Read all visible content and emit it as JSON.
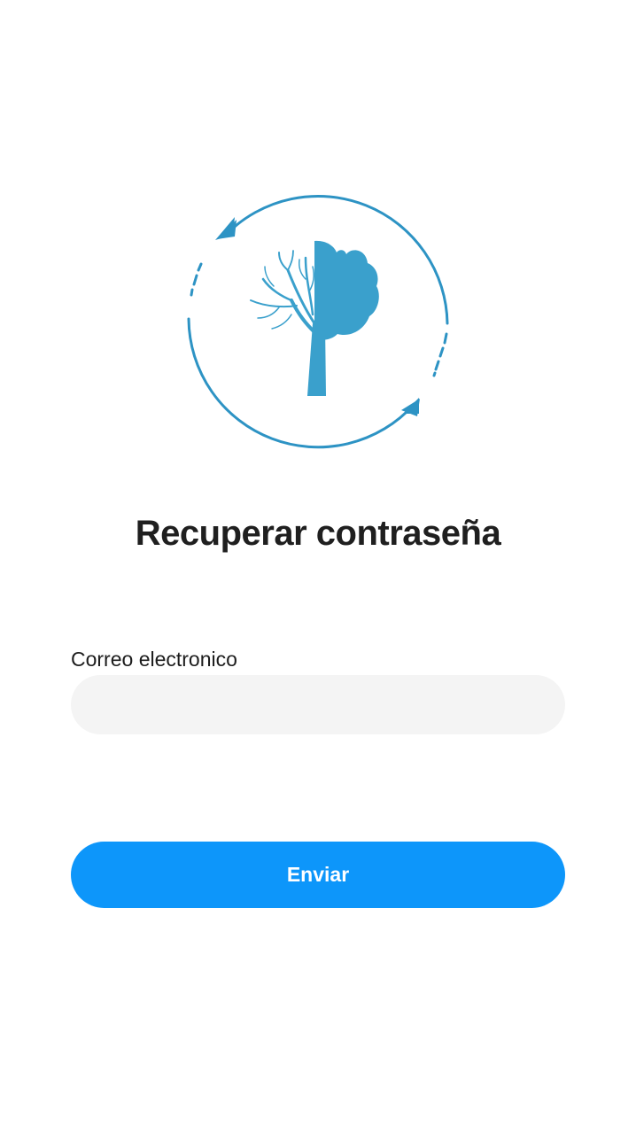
{
  "logo": {
    "icon": "tree-recovery-icon",
    "color": "#3aa0cc"
  },
  "page": {
    "title": "Recuperar contraseña"
  },
  "form": {
    "email_label": "Correo electronico",
    "email_value": "",
    "email_placeholder": ""
  },
  "actions": {
    "submit_label": "Enviar",
    "submit_color": "#0d96fa"
  }
}
